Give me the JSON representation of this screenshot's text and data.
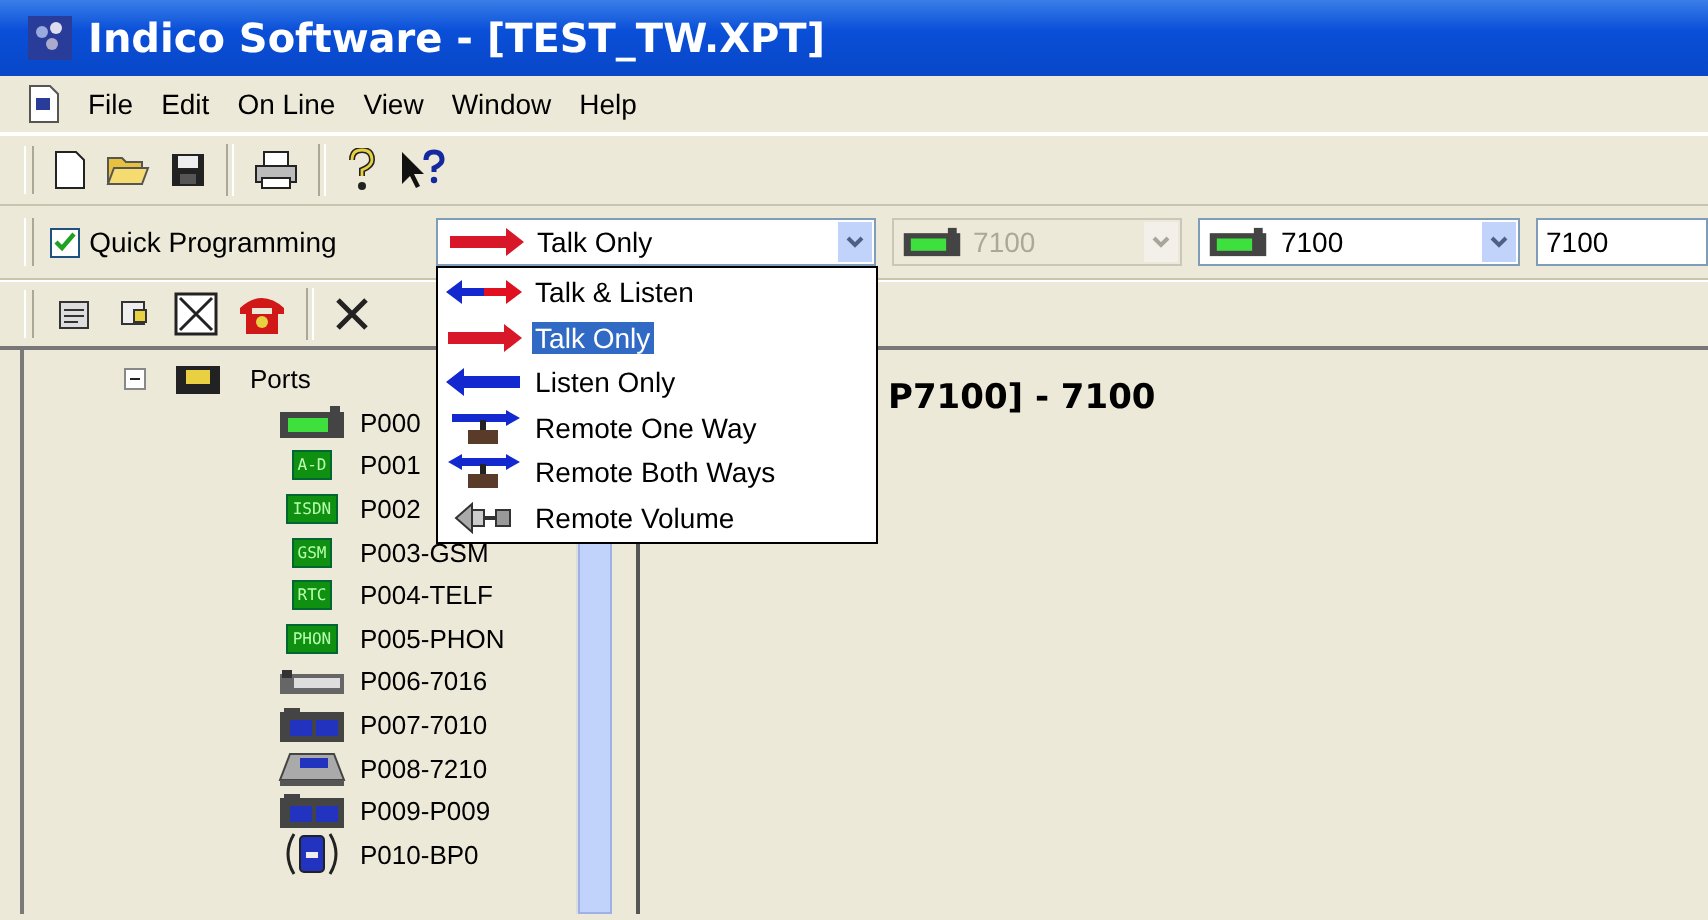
{
  "window": {
    "title": "Indico Software - [TEST_TW.XPT]"
  },
  "menu": [
    "File",
    "Edit",
    "On Line",
    "View",
    "Window",
    "Help"
  ],
  "quick_programming": {
    "label": "Quick Programming",
    "checked": true
  },
  "mode_combo": {
    "value": "Talk Only",
    "kind": "talk",
    "expanded": true
  },
  "mode_options": [
    {
      "label": "Talk & Listen",
      "kind": "talk_listen",
      "selected": false
    },
    {
      "label": "Talk Only",
      "kind": "talk",
      "selected": true
    },
    {
      "label": "Listen Only",
      "kind": "listen",
      "selected": false
    },
    {
      "label": "Remote One Way",
      "kind": "remote_one",
      "selected": false
    },
    {
      "label": "Remote Both Ways",
      "kind": "remote_both",
      "selected": false
    },
    {
      "label": "Remote Volume",
      "kind": "remote_volume",
      "selected": false
    }
  ],
  "panel_combos": [
    {
      "value": "7100",
      "disabled": true
    },
    {
      "value": "7100",
      "disabled": false
    }
  ],
  "panel_field": {
    "value": "7100"
  },
  "tree": {
    "label": "Ports",
    "expanded": true,
    "children": [
      {
        "label": "P000",
        "kind": "radio"
      },
      {
        "label": "P001",
        "kind": "badge",
        "badge": "A-D"
      },
      {
        "label": "P002",
        "kind": "badge",
        "badge": "ISDN"
      },
      {
        "label": "P003-GSM",
        "kind": "badge",
        "badge": "GSM"
      },
      {
        "label": "P004-TELF",
        "kind": "badge",
        "badge": "RTC"
      },
      {
        "label": "P005-PHON",
        "kind": "badge",
        "badge": "PHON"
      },
      {
        "label": "P006-7016",
        "kind": "strip"
      },
      {
        "label": "P007-7010",
        "kind": "panel"
      },
      {
        "label": "P008-7210",
        "kind": "desk"
      },
      {
        "label": "P009-P009",
        "kind": "panel"
      },
      {
        "label": "P010-BP0",
        "kind": "beltpack"
      }
    ]
  },
  "main": {
    "heading": "P7100] - 7100"
  }
}
